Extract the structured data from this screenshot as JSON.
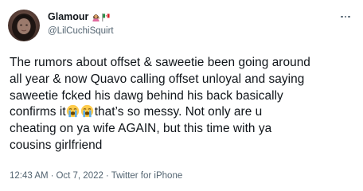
{
  "tweet": {
    "author": {
      "display_name": "Glamour",
      "handle": "@LilCuchiSquirt",
      "avatar_icon": "profile-photo",
      "name_emojis": [
        "person-tipping-hand-icon",
        "mexico-flag-icon"
      ]
    },
    "more_icon": "more-options-icon",
    "body": {
      "line1": "The rumors about offset & saweetie been going around",
      "line2": "all year & now Quavo calling offset unloyal and saying",
      "line3": "saweetie fcked his dawg behind his back basically",
      "line4_prefix": "confirms it",
      "line4_suffix": "that’s so messy. Not only are u",
      "line5": "cheating on ya wife AGAIN, but this time with ya",
      "line6": "cousins girlfriend",
      "emojis": [
        "loudly-crying-face-icon",
        "loudly-crying-face-icon"
      ]
    },
    "meta": {
      "time": "12:43 AM",
      "separator": "·",
      "date": "Oct 7, 2022",
      "source": "Twitter for iPhone"
    }
  },
  "colors": {
    "text_primary": "#0f1419",
    "text_secondary": "#536471",
    "background": "#ffffff"
  }
}
